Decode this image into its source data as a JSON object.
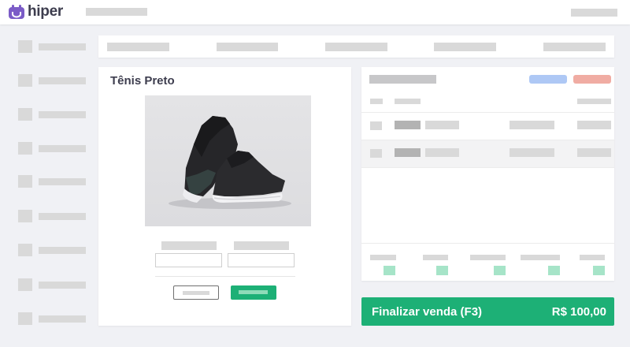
{
  "app": {
    "name": "hiper",
    "brand_color": "#7b5cc7",
    "accent_color": "#1db076",
    "logo_icon": "hiper-logo-icon"
  },
  "sidebar": {
    "item_count": 9,
    "icon": "placeholder-icon"
  },
  "product": {
    "name": "Tênis Preto",
    "image": "black-sneaker-photo",
    "confirm_color": "#1db076"
  },
  "cart": {
    "header_badges": [
      {
        "name": "blue-badge",
        "color": "#aec8f5"
      },
      {
        "name": "red-badge",
        "color": "#f0aca3"
      }
    ],
    "summary_badge_color": "#a6e4c8"
  },
  "checkout": {
    "finalize_label": "Finalizar venda (F3)",
    "total": "R$ 100,00"
  }
}
